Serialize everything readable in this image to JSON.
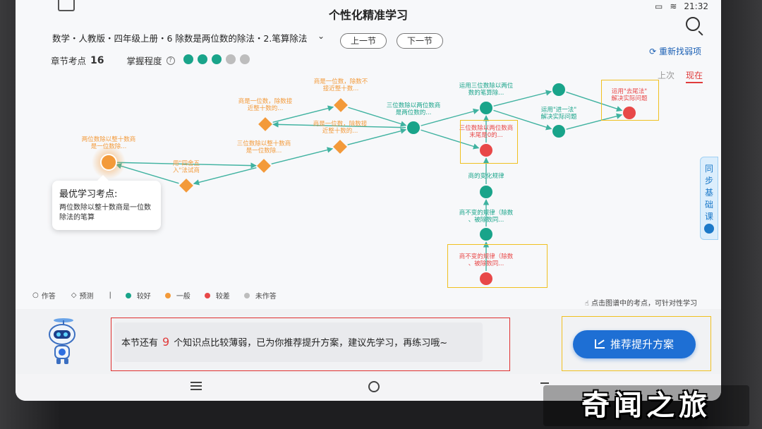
{
  "header": {
    "title": "个性化精准学习",
    "time": "21:32",
    "breadcrumb": "数学・人教版・四年级上册・6 除数是两位数的除法・2.笔算除法",
    "prev_label": "上一节",
    "next_label": "下一节",
    "refresh_label": "重新找弱项"
  },
  "stats": {
    "points_label": "章节考点",
    "points_value": "16",
    "mastery_label": "掌握程度",
    "mastery_levels": [
      "#19a48a",
      "#19a48a",
      "#19a48a",
      "#bdbdbd",
      "#bdbdbd"
    ]
  },
  "view_tabs": {
    "prev": "上次",
    "now": "现在"
  },
  "graph": {
    "colors": {
      "good": "#19a48a",
      "normal": "#f39a3a",
      "poor": "#e84848",
      "none": "#bdbdbd",
      "edge": "#3fb2a0"
    },
    "nodes": [
      {
        "id": "n1",
        "label": "两位数除以整十数商是一位数除...",
        "status": "normal",
        "shape": "circle",
        "highlight": true
      },
      {
        "id": "n2",
        "label": "用\"四舍五入\"法试商",
        "status": "normal",
        "shape": "diamond"
      },
      {
        "id": "n3",
        "label": "三位数除以整十数商是一位数除...",
        "status": "normal",
        "shape": "diamond"
      },
      {
        "id": "n4",
        "label": "商是一位数，除数接近整十数的...",
        "status": "normal",
        "shape": "diamond"
      },
      {
        "id": "n5",
        "label": "商是一位数，除数不接近整十数...",
        "status": "normal",
        "shape": "diamond"
      },
      {
        "id": "n6",
        "label": "商是一位数，除数接近整十数的...",
        "status": "normal",
        "shape": "diamond"
      },
      {
        "id": "n7",
        "label": "三位数除以两位数商是两位数的...",
        "status": "good",
        "shape": "circle"
      },
      {
        "id": "n8",
        "label": "运用三位数除以两位数的笔算除...",
        "status": "good",
        "shape": "circle"
      },
      {
        "id": "n9",
        "label": "三位数除以两位数商末尾是0的...",
        "status": "poor",
        "shape": "circle"
      },
      {
        "id": "n10",
        "label": "",
        "status": "good",
        "shape": "circle"
      },
      {
        "id": "n11",
        "label": "运用\"进一法\"解决实际问题",
        "status": "good",
        "shape": "circle"
      },
      {
        "id": "n12",
        "label": "运用\"去尾法\"解决实际问题",
        "status": "poor",
        "shape": "circle"
      },
      {
        "id": "n13",
        "label": "商的变化规律",
        "status": "good",
        "shape": "circle"
      },
      {
        "id": "n14",
        "label": "商不变的规律（除数、被除数同...",
        "status": "good",
        "shape": "circle"
      },
      {
        "id": "n15",
        "label": "商不变的规律（除数、被除数同...",
        "status": "poor",
        "shape": "circle"
      }
    ]
  },
  "tip": {
    "title": "最优学习考点:",
    "body": "两位数除以整十数商是一位数除法的笔算"
  },
  "side_tab": "同步基础课",
  "legend": {
    "done": "作答",
    "predict": "预测",
    "good": "较好",
    "normal": "一般",
    "poor": "较差",
    "none": "未作答"
  },
  "hint": "点击图谱中的考点，可针对性学习",
  "message": {
    "prefix": "本节还有",
    "count": "9",
    "suffix": "个知识点比较薄弱，已为你推荐提升方案，建议先学习，再练习哦~"
  },
  "cta_label": "推荐提升方案",
  "watermark": "奇闻之旅"
}
